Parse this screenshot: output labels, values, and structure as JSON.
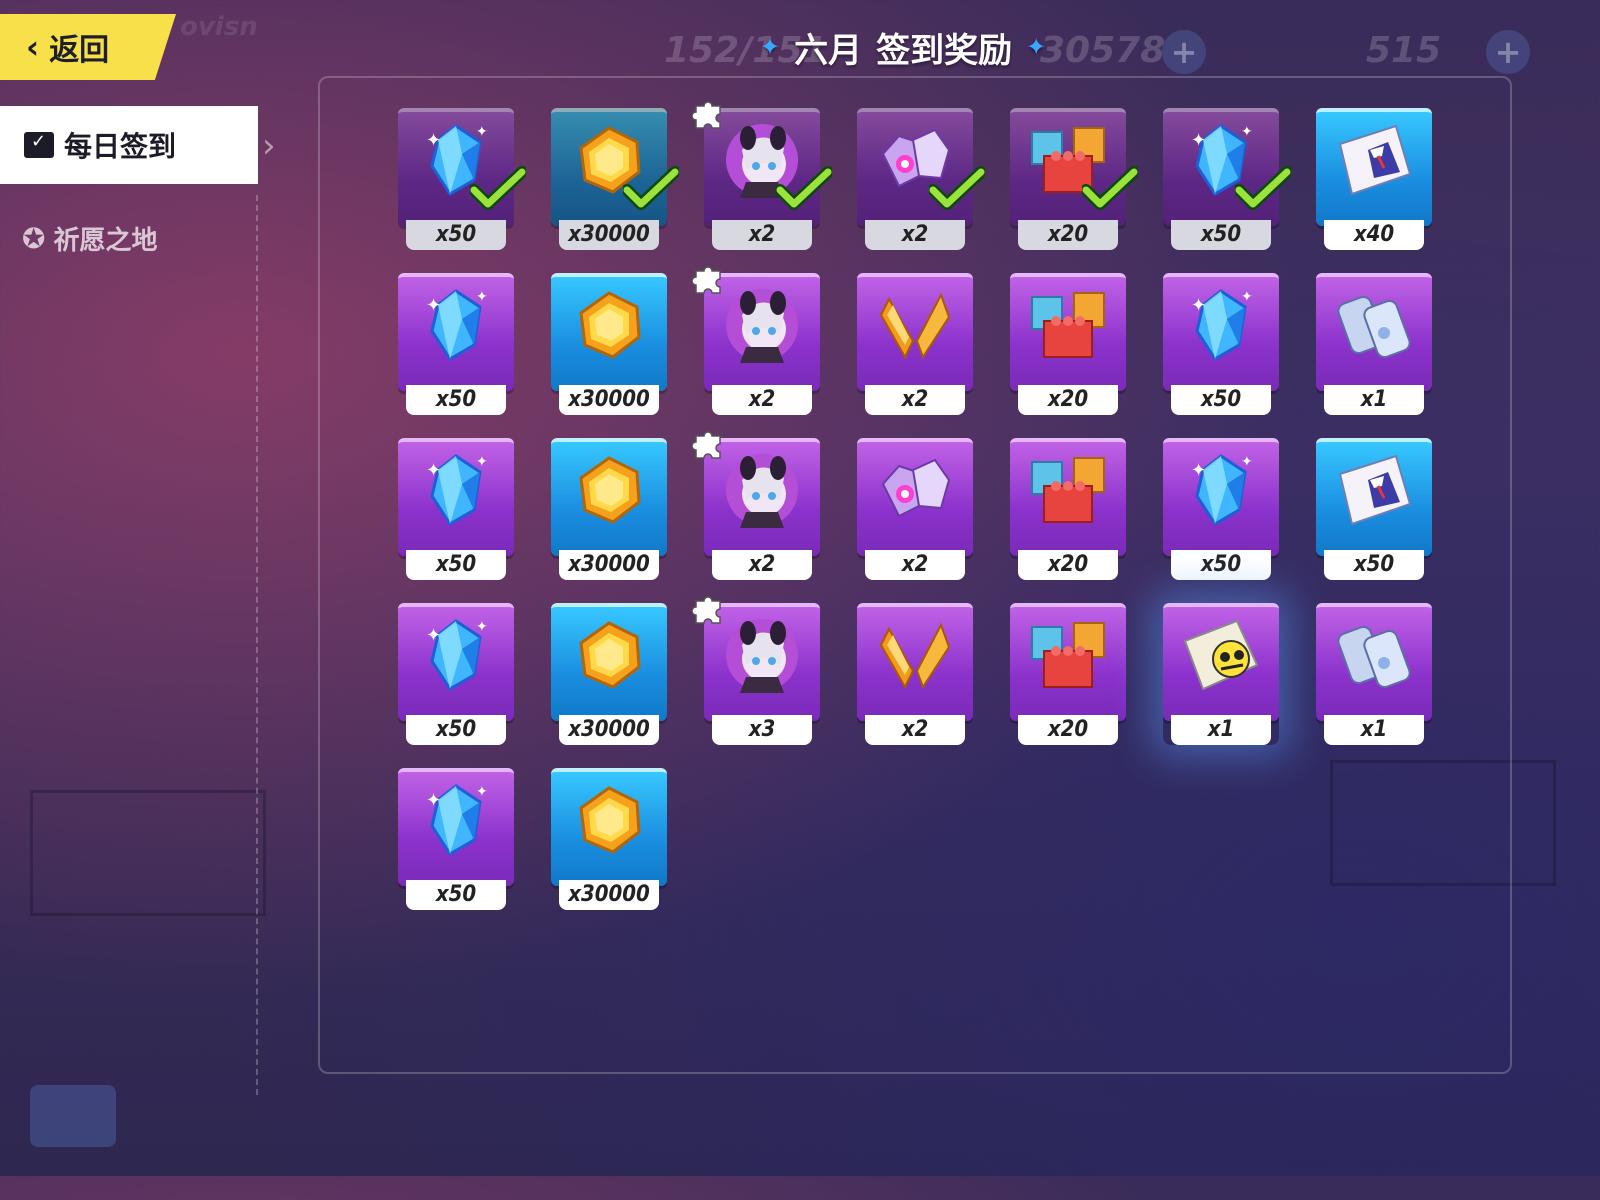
{
  "header": {
    "back_label": "返回",
    "title_month": "六月",
    "title_text": "签到奖励",
    "bg_stat_1": "152/151",
    "bg_stat_2": "30578",
    "bg_stat_3": "515"
  },
  "sidebar": {
    "items": [
      {
        "label": "每日签到",
        "icon": "calendar-check-icon",
        "active": true
      },
      {
        "label": "祈愿之地",
        "icon": "star-wish-icon",
        "active": false
      }
    ]
  },
  "colors": {
    "back_button": "#f8e04a",
    "card_purple": "#9b3fd6",
    "card_blue": "#1a8ee0",
    "check_green": "#9be23c",
    "accent_star": "#3aa7ff"
  },
  "rewards": [
    {
      "item": "crystal",
      "qty": "x50",
      "bg": "purple",
      "claimed": true
    },
    {
      "item": "coin",
      "qty": "x30000",
      "bg": "blue",
      "claimed": true
    },
    {
      "item": "fragment",
      "qty": "x2",
      "bg": "purple",
      "claimed": true,
      "puzzle": true
    },
    {
      "item": "gem-ore",
      "qty": "x2",
      "bg": "purple",
      "claimed": true
    },
    {
      "item": "blocks",
      "qty": "x20",
      "bg": "purple",
      "claimed": true
    },
    {
      "item": "crystal",
      "qty": "x50",
      "bg": "purple",
      "claimed": true
    },
    {
      "item": "outfit-card",
      "qty": "x40",
      "bg": "blue",
      "claimed": false
    },
    {
      "item": "crystal",
      "qty": "x50",
      "bg": "purple",
      "claimed": false
    },
    {
      "item": "coin",
      "qty": "x30000",
      "bg": "blue",
      "claimed": false
    },
    {
      "item": "fragment",
      "qty": "x2",
      "bg": "purple",
      "claimed": false,
      "puzzle": true
    },
    {
      "item": "shard",
      "qty": "x2",
      "bg": "purple",
      "claimed": false
    },
    {
      "item": "blocks",
      "qty": "x20",
      "bg": "purple",
      "claimed": false
    },
    {
      "item": "crystal",
      "qty": "x50",
      "bg": "purple",
      "claimed": false
    },
    {
      "item": "canister",
      "qty": "x1",
      "bg": "purple",
      "claimed": false
    },
    {
      "item": "crystal",
      "qty": "x50",
      "bg": "purple",
      "claimed": false
    },
    {
      "item": "coin",
      "qty": "x30000",
      "bg": "blue",
      "claimed": false
    },
    {
      "item": "fragment",
      "qty": "x2",
      "bg": "purple",
      "claimed": false,
      "puzzle": true
    },
    {
      "item": "gem-ore",
      "qty": "x2",
      "bg": "purple",
      "claimed": false
    },
    {
      "item": "blocks",
      "qty": "x20",
      "bg": "purple",
      "claimed": false
    },
    {
      "item": "crystal",
      "qty": "x50",
      "bg": "purple",
      "claimed": false
    },
    {
      "item": "outfit-card",
      "qty": "x50",
      "bg": "blue",
      "claimed": false
    },
    {
      "item": "crystal",
      "qty": "x50",
      "bg": "purple",
      "claimed": false
    },
    {
      "item": "coin",
      "qty": "x30000",
      "bg": "blue",
      "claimed": false
    },
    {
      "item": "fragment",
      "qty": "x3",
      "bg": "purple",
      "claimed": false,
      "puzzle": true
    },
    {
      "item": "shard",
      "qty": "x2",
      "bg": "purple",
      "claimed": false
    },
    {
      "item": "blocks",
      "qty": "x20",
      "bg": "purple",
      "claimed": false
    },
    {
      "item": "pet-card",
      "qty": "x1",
      "bg": "purple",
      "claimed": false,
      "highlight": true
    },
    {
      "item": "canister",
      "qty": "x1",
      "bg": "purple",
      "claimed": false
    },
    {
      "item": "crystal",
      "qty": "x50",
      "bg": "purple",
      "claimed": false
    },
    {
      "item": "coin",
      "qty": "x30000",
      "bg": "blue",
      "claimed": false
    }
  ]
}
